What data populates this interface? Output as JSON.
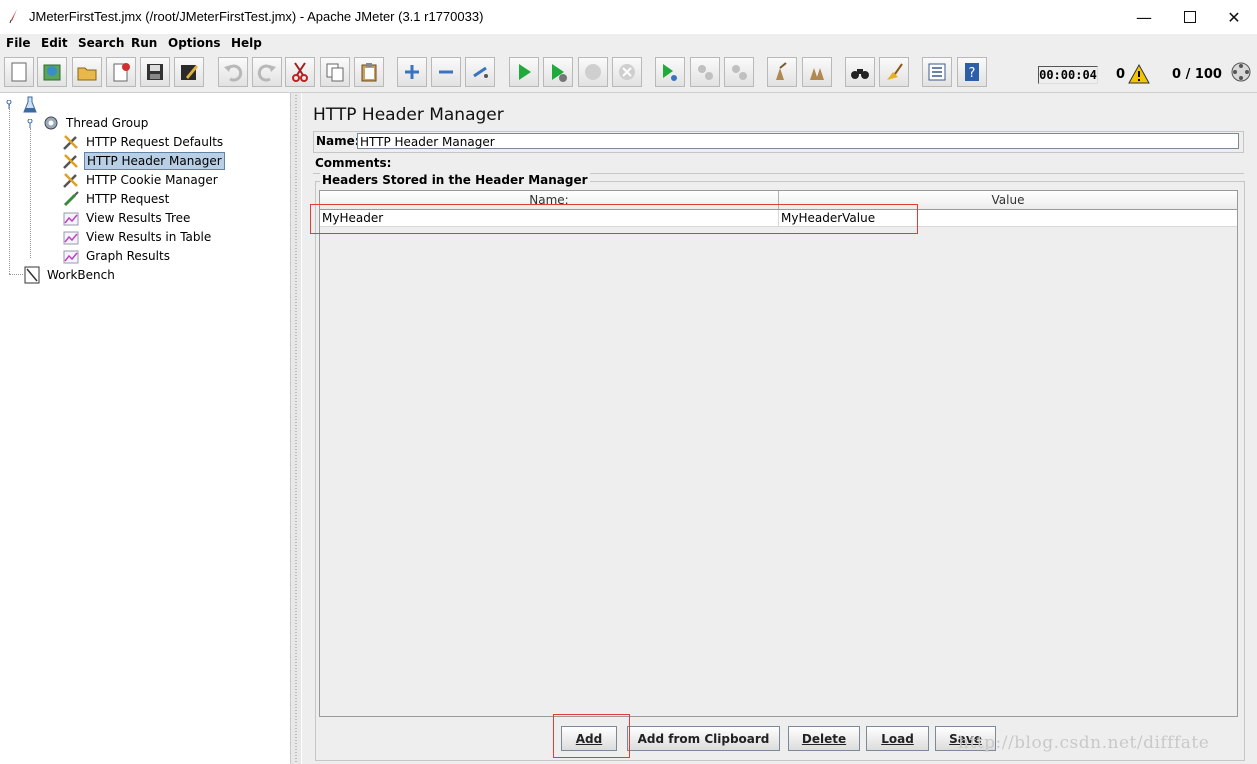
{
  "window": {
    "title": "JMeterFirstTest.jmx (/root/JMeterFirstTest.jmx) - Apache JMeter (3.1 r1770033)",
    "minimize_icon": "minimize-icon",
    "maximize_icon": "maximize-icon",
    "close_icon": "close-icon"
  },
  "menu": [
    "File",
    "Edit",
    "Search",
    "Run",
    "Options",
    "Help"
  ],
  "toolbar": {
    "buttons": [
      "new-icon",
      "templates-icon",
      "open-icon",
      "close-file-icon",
      "save-icon",
      "save-as-icon",
      "undo-icon",
      "redo-icon",
      "cut-icon",
      "copy-icon",
      "paste-icon",
      "expand-icon",
      "collapse-icon",
      "toggle-icon",
      "start-icon",
      "start-no-pauses-icon",
      "stop-icon",
      "shutdown-icon",
      "remote-start-icon",
      "remote-stop-icon",
      "remote-shutdown-icon",
      "clear-icon",
      "clear-all-icon",
      "search-icon",
      "reset-search-icon",
      "function-helper-icon",
      "help-icon"
    ],
    "timer": "00:00:04",
    "error_count": "0",
    "threads": "0 / 100"
  },
  "tree": {
    "root_icon": "test-plan-icon",
    "nodes": [
      {
        "label": "Thread Group",
        "icon": "thread-group-gear-icon"
      },
      {
        "label": "HTTP Request Defaults",
        "icon": "config-wrench-icon"
      },
      {
        "label": "HTTP Header Manager",
        "icon": "config-wrench-icon",
        "selected": true
      },
      {
        "label": "HTTP Cookie Manager",
        "icon": "config-wrench-icon"
      },
      {
        "label": "HTTP Request",
        "icon": "sampler-pipette-icon"
      },
      {
        "label": "View Results Tree",
        "icon": "listener-graph-icon"
      },
      {
        "label": "View Results in Table",
        "icon": "listener-graph-icon"
      },
      {
        "label": "Graph Results",
        "icon": "listener-graph-icon"
      },
      {
        "label": "WorkBench",
        "icon": "workbench-icon"
      }
    ]
  },
  "panel": {
    "heading": "HTTP Header Manager",
    "name_label": "Name:",
    "name_value": "HTTP Header Manager",
    "comments_label": "Comments:",
    "group_title": "Headers Stored in the Header Manager",
    "columns": [
      "Name:",
      "Value"
    ],
    "rows": [
      {
        "name": "MyHeader",
        "value": "MyHeaderValue"
      }
    ],
    "buttons": {
      "add": "Add",
      "add_clipboard": "Add from Clipboard",
      "delete": "Delete",
      "load": "Load",
      "save": "Save"
    }
  },
  "watermark": "http://blog.csdn.net/difffate",
  "colors": {
    "selection": "#b8cfe5",
    "highlight_box": "#e03c3c",
    "panel_bg": "#eeeeee"
  }
}
